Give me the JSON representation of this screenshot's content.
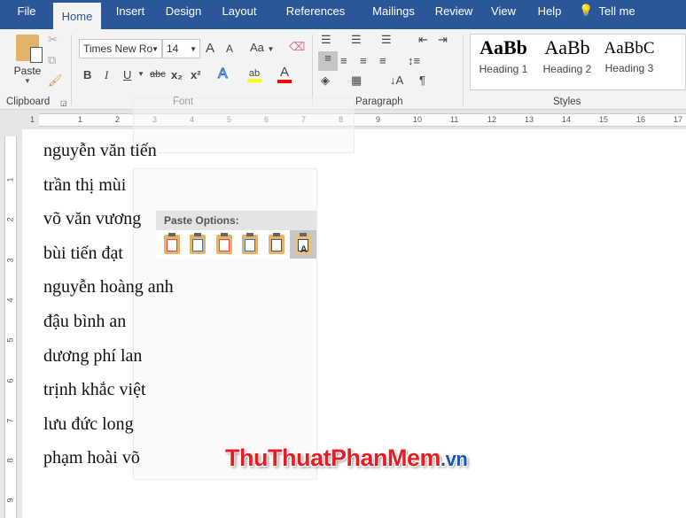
{
  "tabs": [
    "File",
    "Home",
    "Insert",
    "Design",
    "Layout",
    "References",
    "Mailings",
    "Review",
    "View",
    "Help",
    "Tell me"
  ],
  "active_tab": "Home",
  "clipboard": {
    "paste": "Paste",
    "label": "Clipboard"
  },
  "font": {
    "name": "Times New Ro",
    "size": "14",
    "label": "Font",
    "bold": "B",
    "italic": "I",
    "underline": "U",
    "strike": "abc",
    "sub": "x₂",
    "sup": "x²",
    "grow": "A",
    "shrink": "A",
    "case": "Aa",
    "effects": "A",
    "highlight": "ab",
    "color": "A",
    "highlight_color": "#ffff00",
    "font_color": "#ff0000"
  },
  "paragraph": {
    "label": "Paragraph",
    "pilcrow": "¶"
  },
  "styles": {
    "label": "Styles",
    "items": [
      {
        "sample": "AaBb",
        "name": "Heading 1"
      },
      {
        "sample": "AaBb",
        "name": "Heading 2"
      },
      {
        "sample": "AaBbC",
        "name": "Heading 3"
      }
    ]
  },
  "ruler_numbers": [
    "1",
    "1",
    "2",
    "3",
    "4",
    "5",
    "6",
    "7",
    "8",
    "9",
    "10",
    "11",
    "12",
    "13",
    "14",
    "15",
    "16",
    "17"
  ],
  "vruler_numbers": [
    "1",
    "2",
    "3",
    "4",
    "5",
    "6",
    "7",
    "8",
    "9"
  ],
  "document": {
    "lines": [
      "nguyễn văn tiến",
      "trần thị mùi",
      "võ văn vương",
      "bùi tiến đạt",
      "nguyễn hoàng anh",
      "đậu bình an",
      "dương phí lan",
      "trịnh khắc việt",
      "lưu đức long",
      "phạm hoài võ"
    ]
  },
  "paste_options": {
    "title": "Paste Options:",
    "buttons": [
      "keep-source-formatting",
      "use-destination-styles",
      "link-keep-source",
      "link-use-destination",
      "picture",
      "keep-text-only"
    ]
  },
  "watermark": {
    "a": "ThuThuat",
    "b": "PhanMem",
    "c": ".vn"
  },
  "colors": {
    "accent": "#2b579a"
  }
}
